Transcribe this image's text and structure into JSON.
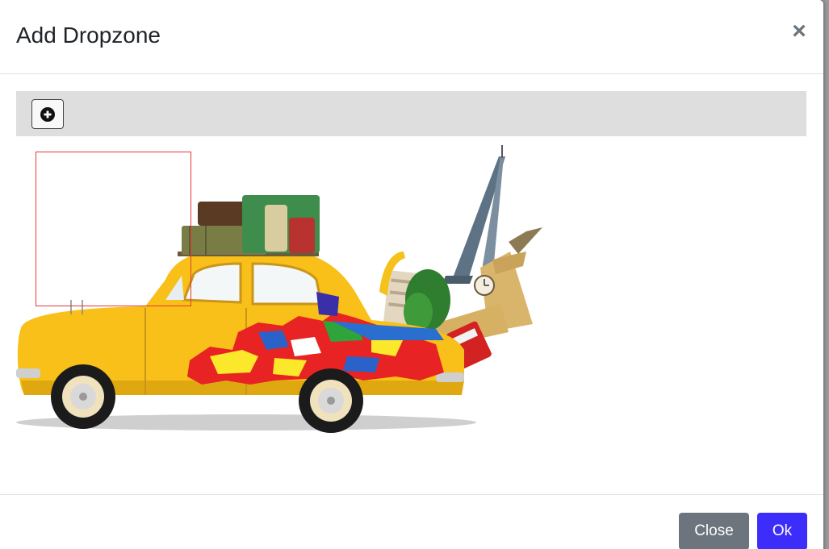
{
  "modal": {
    "title": "Add Dropzone",
    "close_icon": "×"
  },
  "toolbar": {
    "add_icon": "plus-circle-icon"
  },
  "image": {
    "subject": "travel-car-illustration"
  },
  "footer": {
    "close_label": "Close",
    "ok_label": "Ok"
  },
  "colors": {
    "primary": "#3d2dfb",
    "secondary": "#6c757d",
    "dropzone_border": "#e53935",
    "toolbar_bg": "#dedede"
  }
}
